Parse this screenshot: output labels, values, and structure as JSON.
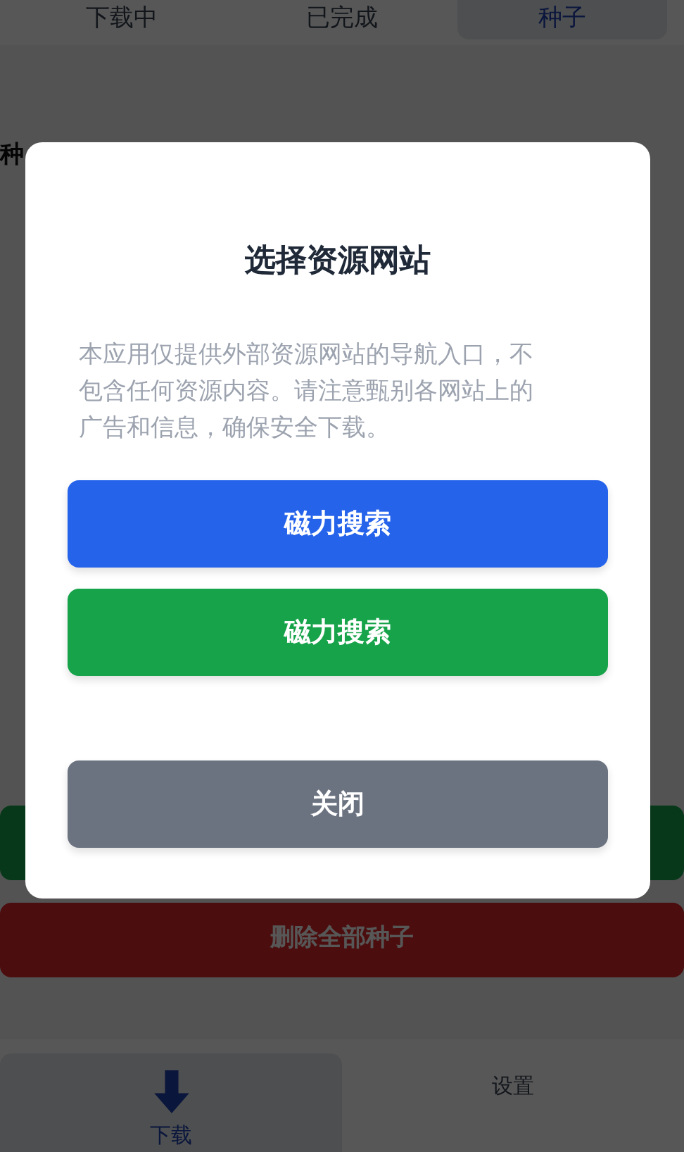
{
  "tabs": [
    {
      "label": "下载中",
      "selected": false
    },
    {
      "label": "已完成",
      "selected": false
    },
    {
      "label": "种子",
      "selected": true
    }
  ],
  "section_heading": "种",
  "actions": [
    {
      "kind": "success"
    },
    {
      "kind": "danger",
      "label": "删除全部种子"
    }
  ],
  "bottom_nav": [
    {
      "label": "下载",
      "kind": "download",
      "selected": true
    },
    {
      "label": "设置",
      "kind": "settings",
      "selected": false
    }
  ],
  "dialog": {
    "title": "选择资源网站",
    "message": "本应用仅提供外部资源网站的导航入口，不包含任何资源内容。请注意甄别各网站上的广告和信息，确保安全下载。",
    "buttons": [
      {
        "label": "磁力搜索",
        "kind": "primary"
      },
      {
        "label": "磁力搜索",
        "kind": "success"
      },
      {
        "label": "关闭",
        "kind": "secondary"
      }
    ]
  }
}
